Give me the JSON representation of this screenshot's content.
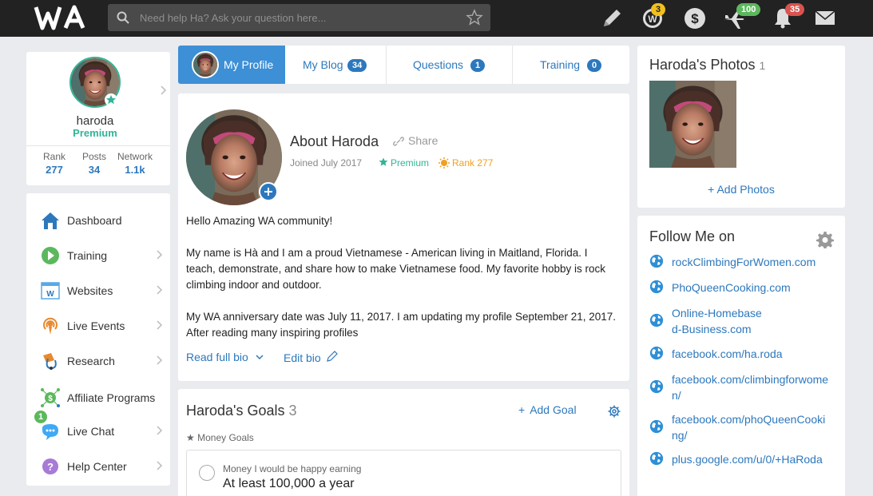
{
  "topbar": {
    "search_placeholder": "Need help Ha? Ask your question here...",
    "badges": {
      "rank": "3",
      "airplane": "100",
      "bell": "35"
    },
    "colors": {
      "bar": "#222222",
      "badge_gold": "#f2c01c",
      "badge_green": "#5cb85c",
      "badge_red": "#d9534f"
    }
  },
  "profile": {
    "username": "haroda",
    "membership": "Premium",
    "stats": [
      {
        "label": "Rank",
        "value": "277"
      },
      {
        "label": "Posts",
        "value": "34"
      },
      {
        "label": "Network",
        "value": "1.1k"
      }
    ]
  },
  "nav": {
    "items": [
      {
        "label": "Dashboard",
        "icon": "home-icon"
      },
      {
        "label": "Training",
        "icon": "play-icon"
      },
      {
        "label": "Websites",
        "icon": "website-icon"
      },
      {
        "label": "Live Events",
        "icon": "broadcast-icon"
      },
      {
        "label": "Research",
        "icon": "research-icon"
      },
      {
        "label": "Affiliate Programs",
        "icon": "affiliate-icon"
      },
      {
        "label": "Live Chat",
        "icon": "chat-icon",
        "badge": "1"
      },
      {
        "label": "Help Center",
        "icon": "help-icon"
      }
    ]
  },
  "tabs": [
    {
      "label": "My Profile"
    },
    {
      "label": "My Blog",
      "count": "34"
    },
    {
      "label": "Questions",
      "count": "1"
    },
    {
      "label": "Training",
      "count": "0"
    }
  ],
  "about": {
    "title": "About Haroda",
    "share": "Share",
    "joined": "Joined July 2017",
    "premium": "Premium",
    "rank": "Rank 277",
    "bio": [
      "Hello Amazing WA community!",
      "My name is Hà and I am a proud Vietnamese - American living in Maitland, Florida. I teach, demonstrate, and share how to make Vietnamese food. My favorite hobby is rock climbing indoor and outdoor.",
      "My WA anniversary date was July 11, 2017. I am updating my profile September 21, 2017. After reading many inspiring profiles"
    ],
    "read_full": "Read full bio",
    "edit_bio": "Edit bio"
  },
  "goals": {
    "title": "Haroda's Goals",
    "count": "3",
    "add": "Add Goal",
    "category": "Money Goals",
    "item_label": "Money I would be happy earning",
    "item_value": "At least 100,000 a year"
  },
  "photos": {
    "title": "Haroda's Photos",
    "count": "1",
    "add": "+ Add Photos"
  },
  "follow": {
    "title": "Follow Me on",
    "links": [
      "rockClimbingForWomen.com",
      "PhoQueenCooking.com",
      "Online-Homebased-Business.com",
      "facebook.com/ha.roda",
      "facebook.com/climbingforwomen/",
      "facebook.com/phoQueenCooking/",
      "plus.google.com/u/0/+HaRoda"
    ]
  }
}
